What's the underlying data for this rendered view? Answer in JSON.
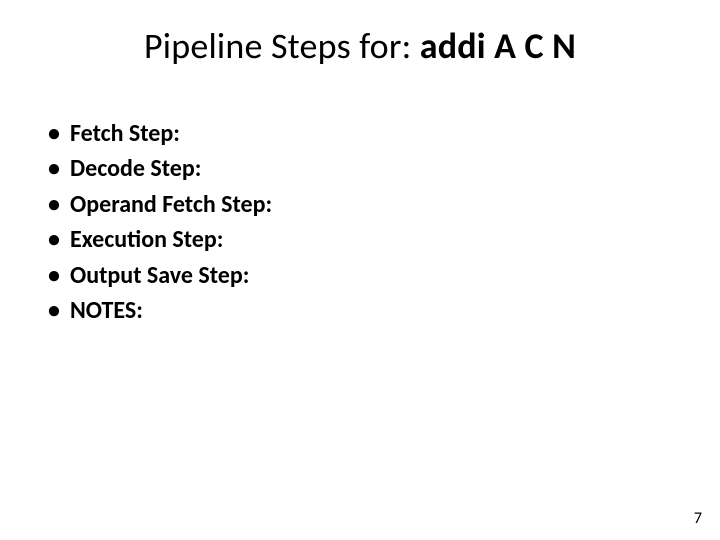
{
  "title": {
    "prefix": "Pipeline Steps for: ",
    "bold": "addi A C N"
  },
  "steps": [
    "Fetch Step:",
    "Decode Step:",
    "Operand Fetch Step:",
    "Execution Step:",
    "Output Save Step:"
  ],
  "notes_label": "NOTES:",
  "page_number": "7"
}
